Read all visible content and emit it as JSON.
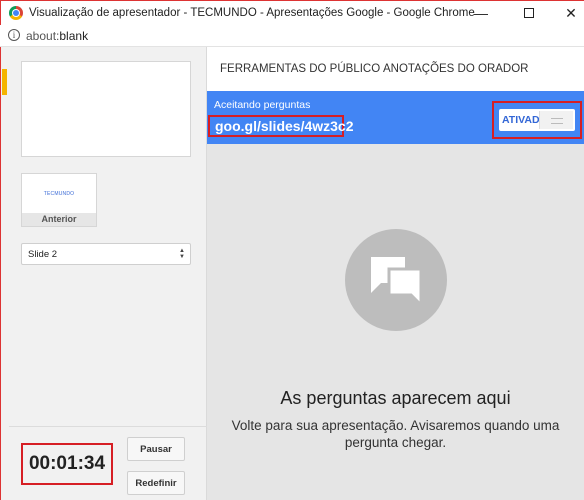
{
  "window": {
    "title": "Visualização de apresentador - TECMUNDO - Apresentações Google - Google Chrome",
    "minimize": "—",
    "close": "✕"
  },
  "address": {
    "prefix": "about:",
    "value": "blank"
  },
  "left": {
    "thumbnail": {
      "logo_text": "TECMUNDO",
      "label": "Anterior"
    },
    "slide_select": {
      "value": "Slide 2"
    },
    "timer": "00:01:34",
    "buttons": {
      "pause": "Pausar",
      "reset": "Redefinir"
    }
  },
  "right": {
    "tabs": [
      {
        "label": "FERRAMENTAS DO PÚBLICO"
      },
      {
        "label": "ANOTAÇÕES DO ORADOR"
      }
    ],
    "qa": {
      "label": "Aceitando perguntas",
      "link": "goo.gl/slides/4wz3c2",
      "toggle_label": "ATIVADO"
    },
    "empty": {
      "title": "As perguntas aparecem aqui",
      "text": "Volte para sua apresentação. Avisaremos quando uma pergunta chegar."
    }
  },
  "colors": {
    "accent": "#4285f4",
    "highlight": "#d61e24"
  }
}
